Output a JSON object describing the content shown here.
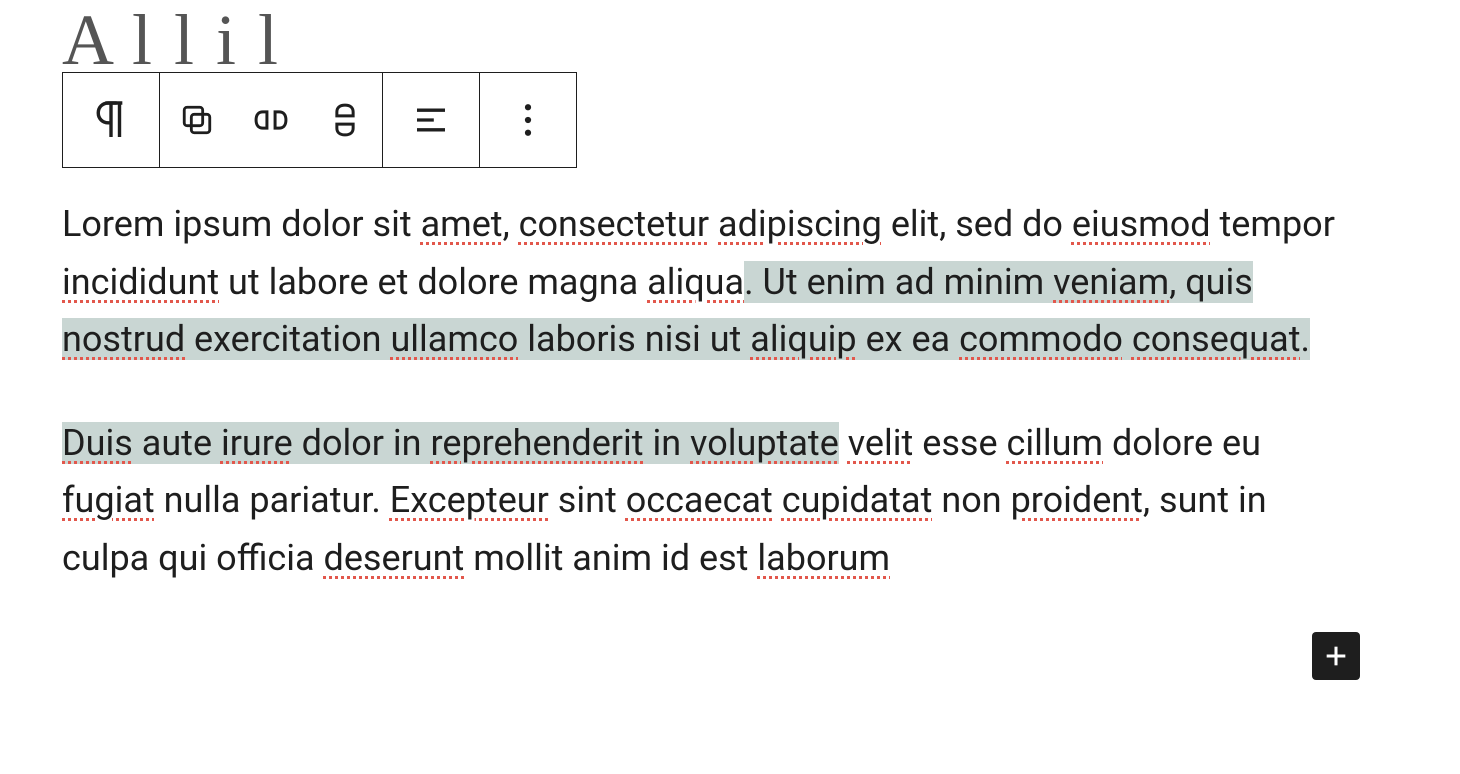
{
  "title_peek": "A   l  l     i    l",
  "toolbar": {
    "block_type": "paragraph",
    "icons": {
      "paragraph": "paragraph-icon",
      "group": "group-icon",
      "shuffle": "row-icon",
      "stack": "stack-icon",
      "align": "align-icon",
      "more": "more-icon"
    }
  },
  "paragraphs": {
    "p1": {
      "seg1": "Lorem ipsum dolor sit ",
      "w_amet": "amet",
      "seg2": ", ",
      "w_consectetur": "consectetur",
      "seg3": " ",
      "w_adipiscing": "adipiscing",
      "seg4": " elit, sed do ",
      "w_eiusmod": "eiusmod",
      "seg5": " tempor ",
      "w_incididunt": "incididunt",
      "seg6": " ut labore et dolore magna ",
      "w_aliqua": "aliqua",
      "seg7_sel_start": ". Ut enim ad minim ",
      "w_veniam": "veniam",
      "seg8": ", quis ",
      "w_nostrud": "nostrud",
      "seg9": " exercitation ",
      "w_ullamco": "ullamco",
      "seg10": " laboris nisi ut ",
      "w_aliquip": "aliquip",
      "seg11": " ex ea ",
      "w_commodo": "commodo",
      "seg12": " ",
      "w_consequat": "consequat",
      "seg13": ". "
    },
    "p2": {
      "w_duis": "Duis",
      "seg1": " aute ",
      "w_irure": "irure",
      "seg2": " dolor in ",
      "w_reprehenderit": "reprehenderit",
      "seg3": " in ",
      "w_voluptate_part": "voluptate",
      "seg4_after_sel": " ",
      "w_velit": "velit",
      "seg5": " esse ",
      "w_cillum": "cillum",
      "seg6": " dolore eu ",
      "w_fugiat": "fugiat",
      "seg7": " nulla pariatur. ",
      "w_excepteur": "Excepteur",
      "seg8": " sint ",
      "w_occaecat": "occaecat",
      "seg9": " ",
      "w_cupidatat": "cupidatat",
      "seg10": " non ",
      "w_proident": "proident",
      "seg11": ", sunt in culpa qui officia ",
      "w_deserunt": "deserunt",
      "seg12": " mollit anim id est ",
      "w_laborum": "laborum"
    }
  },
  "add_block_label": "Add block"
}
